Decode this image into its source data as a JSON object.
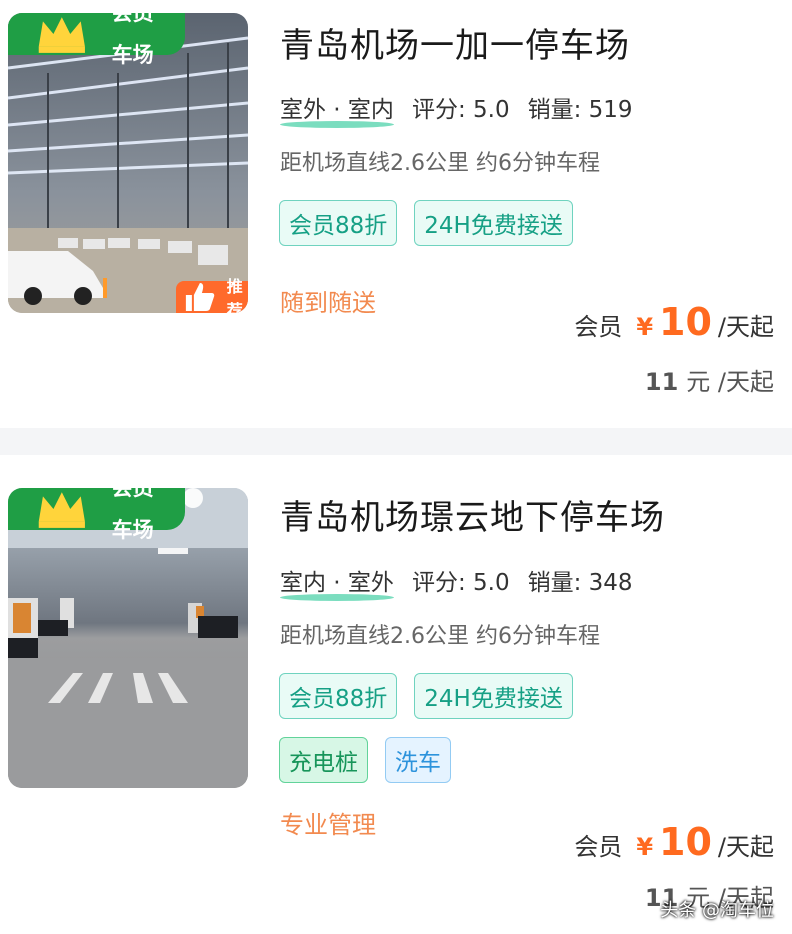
{
  "lots": [
    {
      "member_tag": "会员车场",
      "recommend": "推荐",
      "title": "青岛机场一加一停车场",
      "kind": "室外 · 室内",
      "rating_label": "评分:",
      "rating": "5.0",
      "sales_label": "销量:",
      "sales": "519",
      "distance": "距机场直线2.6公里 约6分钟车程",
      "tags_row1": [
        "会员88折",
        "24H免费接送"
      ],
      "feature": "随到随送",
      "price_label": "会员",
      "currency": "¥",
      "price": "10",
      "price_unit": "/天起",
      "orig_price": "11",
      "orig_unit": "元 /天起"
    },
    {
      "member_tag": "会员车场",
      "title": "青岛机场璟云地下停车场",
      "kind": "室内 · 室外",
      "rating_label": "评分:",
      "rating": "5.0",
      "sales_label": "销量:",
      "sales": "348",
      "distance": "距机场直线2.6公里 约6分钟车程",
      "tags_row1": [
        "会员88折",
        "24H免费接送"
      ],
      "tags_row2": [
        "充电桩",
        "洗车"
      ],
      "feature": "专业管理",
      "price_label": "会员",
      "currency": "¥",
      "price": "10",
      "price_unit": "/天起",
      "orig_price": "11",
      "orig_unit": "元 /天起"
    }
  ],
  "watermark": "头条 @淘车位",
  "colors": {
    "member_green": "#1f9e45",
    "price_orange": "#ff6a1f",
    "feature_orange": "#f28a4f",
    "tag_teal": "#16a085"
  }
}
